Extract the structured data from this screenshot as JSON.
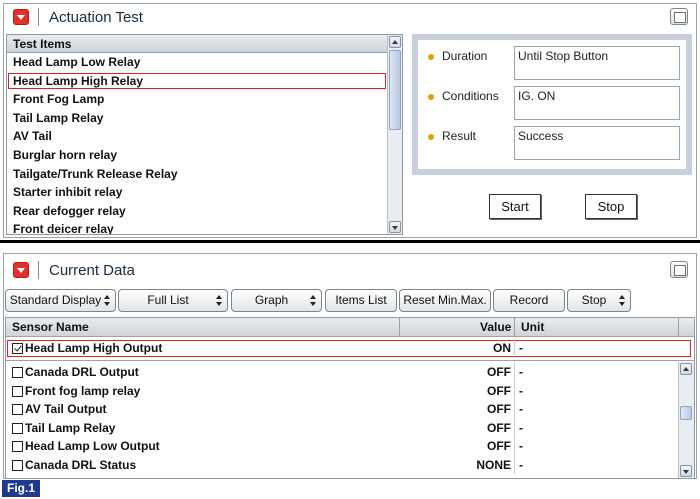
{
  "actuation": {
    "title": "Actuation Test",
    "list_header": "Test Items",
    "items": [
      "Head Lamp Low Relay",
      "Head Lamp High Relay",
      "Front Fog Lamp",
      "Tail Lamp Relay",
      "AV Tail",
      "Burglar horn relay",
      "Tailgate/Trunk Release Relay",
      "Starter inhibit relay",
      "Rear defogger relay",
      "Front deicer relay"
    ],
    "selected_item": "Head Lamp High Relay",
    "duration_label": "Duration",
    "duration_value": "Until Stop Button",
    "conditions_label": "Conditions",
    "conditions_value": "IG. ON",
    "result_label": "Result",
    "result_value": "Success",
    "start_label": "Start",
    "stop_label": "Stop"
  },
  "current_data": {
    "title": "Current Data",
    "toolbar": {
      "standard_display": "Standard Display",
      "full_list": "Full List",
      "graph": "Graph",
      "items_list": "Items List",
      "reset_minmax": "Reset Min.Max.",
      "record": "Record",
      "stop": "Stop"
    },
    "columns": {
      "sensor": "Sensor Name",
      "value": "Value",
      "unit": "Unit"
    },
    "fixed_row": {
      "name": "Head Lamp High Output",
      "value": "ON",
      "unit": "-",
      "checked": true
    },
    "rows": [
      {
        "name": "Canada DRL Output",
        "value": "OFF",
        "unit": "-",
        "checked": false
      },
      {
        "name": "Front fog lamp relay",
        "value": "OFF",
        "unit": "-",
        "checked": false
      },
      {
        "name": "AV Tail Output",
        "value": "OFF",
        "unit": "-",
        "checked": false
      },
      {
        "name": "Tail Lamp Relay",
        "value": "OFF",
        "unit": "-",
        "checked": false
      },
      {
        "name": "Head Lamp Low Output",
        "value": "OFF",
        "unit": "-",
        "checked": false
      },
      {
        "name": "Canada DRL Status",
        "value": "NONE",
        "unit": "-",
        "checked": false
      }
    ]
  },
  "figure_label": "Fig.1",
  "colors": {
    "accent_red": "#e0322a",
    "selection_outline": "#dd2222",
    "figure_badge": "#1e3a8c",
    "info_border": "#c7cfdc"
  }
}
